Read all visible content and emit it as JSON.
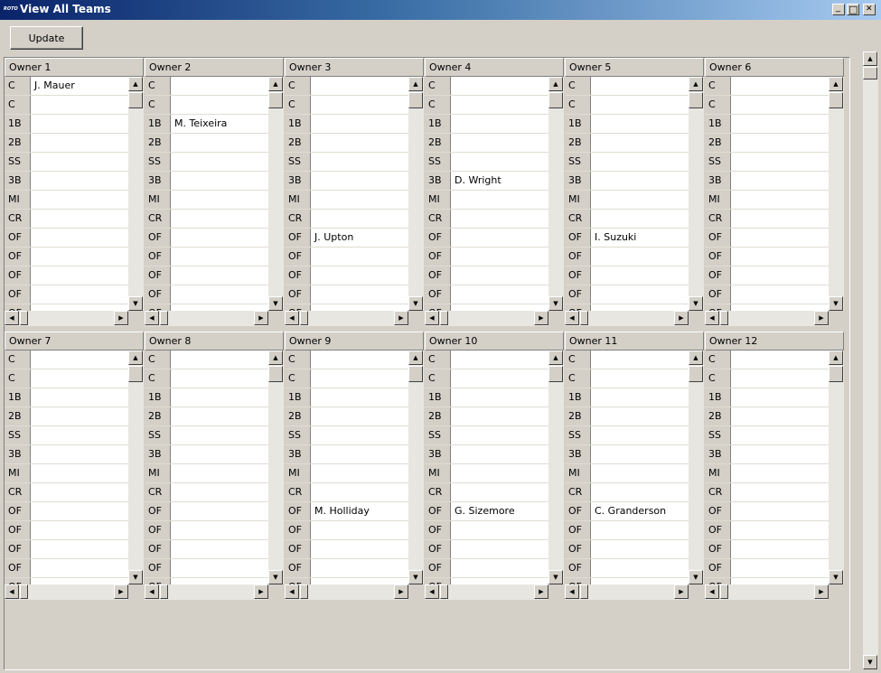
{
  "window": {
    "app_label": "ROTO",
    "title": "View All Teams",
    "minimize_glyph": "_",
    "maximize_glyph": "□",
    "close_glyph": "✕"
  },
  "toolbar": {
    "update_label": "Update"
  },
  "scroll_glyphs": {
    "up": "▲",
    "down": "▼",
    "left": "◀",
    "right": "▶"
  },
  "positions": [
    "C",
    "C",
    "1B",
    "2B",
    "SS",
    "3B",
    "MI",
    "CR",
    "OF",
    "OF",
    "OF",
    "OF",
    "OF"
  ],
  "teams": [
    {
      "owner": "Owner 1",
      "players": [
        "J. Mauer",
        "",
        "",
        "",
        "",
        "",
        "",
        "",
        "",
        "",
        "",
        "",
        ""
      ]
    },
    {
      "owner": "Owner 2",
      "players": [
        "",
        "",
        "M. Teixeira",
        "",
        "",
        "",
        "",
        "",
        "",
        "",
        "",
        "",
        ""
      ]
    },
    {
      "owner": "Owner 3",
      "players": [
        "",
        "",
        "",
        "",
        "",
        "",
        "",
        "",
        "J. Upton",
        "",
        "",
        "",
        ""
      ]
    },
    {
      "owner": "Owner 4",
      "players": [
        "",
        "",
        "",
        "",
        "",
        "D. Wright",
        "",
        "",
        "",
        "",
        "",
        "",
        ""
      ]
    },
    {
      "owner": "Owner 5",
      "players": [
        "",
        "",
        "",
        "",
        "",
        "",
        "",
        "",
        "I. Suzuki",
        "",
        "",
        "",
        ""
      ]
    },
    {
      "owner": "Owner 6",
      "players": [
        "",
        "",
        "",
        "",
        "",
        "",
        "",
        "",
        "",
        "",
        "",
        "",
        ""
      ]
    },
    {
      "owner": "Owner 7",
      "players": [
        "",
        "",
        "",
        "",
        "",
        "",
        "",
        "",
        "",
        "",
        "",
        "",
        ""
      ]
    },
    {
      "owner": "Owner 8",
      "players": [
        "",
        "",
        "",
        "",
        "",
        "",
        "",
        "",
        "",
        "",
        "",
        "",
        ""
      ]
    },
    {
      "owner": "Owner 9",
      "players": [
        "",
        "",
        "",
        "",
        "",
        "",
        "",
        "",
        "M. Holliday",
        "",
        "",
        "",
        ""
      ]
    },
    {
      "owner": "Owner 10",
      "players": [
        "",
        "",
        "",
        "",
        "",
        "",
        "",
        "",
        "G. Sizemore",
        "",
        "",
        "",
        ""
      ]
    },
    {
      "owner": "Owner 11",
      "players": [
        "",
        "",
        "",
        "",
        "",
        "",
        "",
        "",
        "C. Granderson",
        "",
        "",
        "",
        ""
      ]
    },
    {
      "owner": "Owner 12",
      "players": [
        "",
        "",
        "",
        "",
        "",
        "",
        "",
        "",
        "",
        "",
        "",
        "",
        ""
      ]
    }
  ]
}
